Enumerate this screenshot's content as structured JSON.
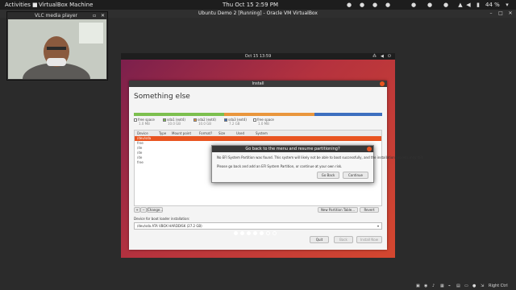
{
  "host": {
    "activities": "Activities",
    "app_menu": "VirtualBox Machine",
    "clock": "Thu Oct 15  2:59 PM",
    "battery": "44 %",
    "tray_icons": [
      "network-icon",
      "volume-icon",
      "power-icon"
    ]
  },
  "vbox": {
    "title": "Ubuntu Demo 2 [Running] - Oracle VM VirtualBox",
    "host_key": "Right Ctrl"
  },
  "vlc": {
    "title": "VLC media player"
  },
  "guest": {
    "clock": "Oct 15  13:59"
  },
  "installer": {
    "title": "Install",
    "heading": "Something else",
    "legend": [
      {
        "label": "free space",
        "size": "1.0 MB",
        "color": "#ffffff"
      },
      {
        "label": "sda1 (ext4)",
        "size": "10.0 GB",
        "color": "#7cbf4f"
      },
      {
        "label": "sda2 (ext4)",
        "size": "10.0 GB",
        "color": "#e9963d"
      },
      {
        "label": "sda3 (ext4)",
        "size": "7.2 GB",
        "color": "#3d6fbf"
      },
      {
        "label": "free space",
        "size": "1.0 MB",
        "color": "#ffffff"
      }
    ],
    "columns": [
      "Device",
      "Type",
      "Mount point",
      "Format?",
      "Size",
      "Used",
      "System"
    ],
    "selected_row": "/dev/sda",
    "rows": [
      "free",
      "/de",
      "/de",
      "/de",
      "free"
    ],
    "buttons": {
      "add": "+",
      "remove": "−",
      "change": "Change...",
      "new_table": "New Partition Table...",
      "revert": "Revert",
      "quit": "Quit",
      "back": "Back",
      "install": "Install Now"
    },
    "boot_label": "Device for boot loader installation:",
    "boot_device": "/dev/sda   ATA VBOX HARDDISK (27.2 GB)"
  },
  "dialog": {
    "title": "Go back to the menu and resume partitioning?",
    "line1": "No EFI System Partition was found. This system will likely not be able to boot successfully, and the installation process may fail.",
    "line2": "Please go back and add an EFI System Partition, or continue at your own risk.",
    "go_back": "Go Back",
    "continue": "Continue"
  }
}
